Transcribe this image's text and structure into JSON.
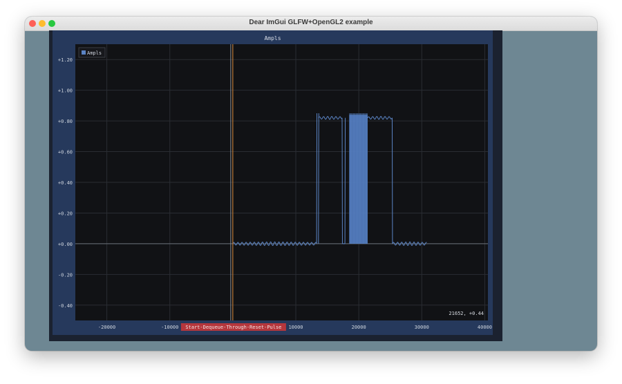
{
  "window": {
    "title": "Dear ImGui GLFW+OpenGL2 example"
  },
  "plot": {
    "title": "Ampls",
    "legend_label": "Ampls",
    "tag_label": "Start-Dequeue-Through-Reset-Pulse",
    "mouse_readout": "21652, +0.44"
  },
  "colors": {
    "series": "#5b84c4",
    "series_fill": "#4a74b8",
    "tag_bg": "#b5363c",
    "vline_orange": "#d9893a"
  },
  "chart_data": {
    "type": "line",
    "title": "Ampls",
    "xlabel": "",
    "ylabel": "",
    "xlim": [
      -25000,
      40500
    ],
    "ylim": [
      -0.5,
      1.3
    ],
    "x_ticks": [
      -20000,
      -10000,
      0,
      10000,
      20000,
      30000,
      40000
    ],
    "x_tick_labels": [
      "-20000",
      "-10000",
      "0",
      "10000",
      "20000",
      "30000",
      "40000"
    ],
    "y_ticks": [
      1.2,
      1.0,
      0.8,
      0.6,
      0.4,
      0.2,
      0.0,
      -0.2,
      -0.4
    ],
    "y_tick_labels": [
      "+1.20",
      "+1.00",
      "+0.80",
      "+0.60",
      "+0.40",
      "+0.20",
      "+0.00",
      "-0.20",
      "-0.40"
    ],
    "grid": true,
    "legend": "top-left",
    "vlines": [
      {
        "x": 0,
        "label": "Start-Dequeue-Through-Reset-Pulse"
      }
    ],
    "series": [
      {
        "name": "Ampls",
        "segments": [
          {
            "x_start": 0,
            "x_end": 13500,
            "level": 0.0
          },
          {
            "x_start": 13500,
            "x_end": 17500,
            "level": 0.82
          },
          {
            "x_start": 17500,
            "x_end": 17800,
            "level": 0.0
          },
          {
            "x_start": 17800,
            "x_end": 25600,
            "level": 0.82
          },
          {
            "x_start": 25600,
            "x_end": 31000,
            "level": 0.0
          }
        ]
      }
    ]
  }
}
